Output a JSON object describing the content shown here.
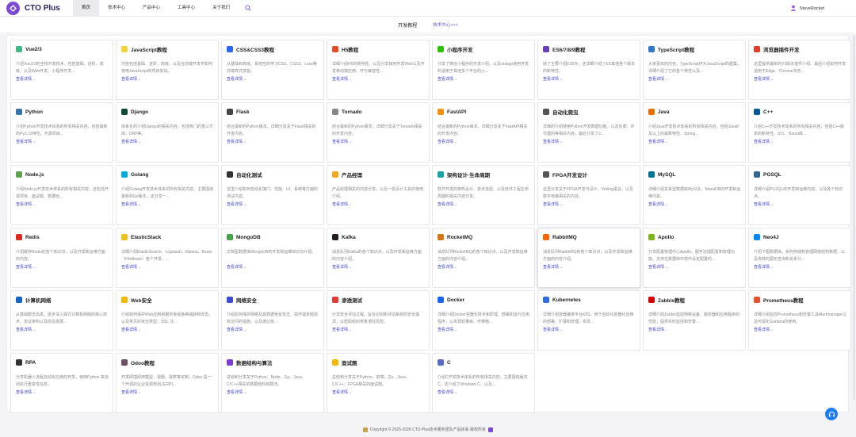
{
  "brand": {
    "name": "CTO Plus"
  },
  "nav": [
    {
      "label": "首页",
      "active": true
    },
    {
      "label": "技术中心",
      "active": false
    },
    {
      "label": "产品中心",
      "active": false
    },
    {
      "label": "工具中心",
      "active": false
    },
    {
      "label": "关于我们",
      "active": false
    }
  ],
  "user": {
    "name": "SteveRocket"
  },
  "subheader": {
    "title": "开发教程",
    "link": "技术中心>>>"
  },
  "link_label": "查看详情→",
  "cards": [
    {
      "title": "Vue2/3",
      "desc": "介绍Vue2/3的全栈开发技术。包括基础、进阶、高级，以及Web开发、小程序开发...",
      "icon": "vue-icon",
      "color": "#41b883"
    },
    {
      "title": "JavaScript教程",
      "desc": "内容包括基础、进阶、高级，以及在前端开发中如何使用JavaScript的项目实战。",
      "icon": "javascript-icon",
      "color": "#f0d43a"
    },
    {
      "title": "CSS&CSS3教程",
      "desc": "从基础到高级，系统性的学习CSS、CSS3、Less等前端样式技能。",
      "icon": "css-icon",
      "color": "#2965f1"
    },
    {
      "title": "H5教程",
      "desc": "详细介绍H5的新特性，以及分享如何开发Web以及开发移动端应用、开与兼容性...",
      "icon": "html5-icon",
      "color": "#e44d26"
    },
    {
      "title": "小程序开发",
      "desc": "分享了微信小程序的开发介绍，以及uniapp使用开发的适用于其他多个平台的小...",
      "icon": "wechat-icon",
      "color": "#2dc100"
    },
    {
      "title": "ES6/7/8/9教程",
      "desc": "除了主要介绍ES6外，还详细介绍了ES其他各个版本的新特性。",
      "icon": "es-icon",
      "color": "#6a3ec2"
    },
    {
      "title": "TypeScript教程",
      "desc": "大家喜欢的内容，TypeScript作为JavaScript的超集，详细介绍了它的各个特性以及...",
      "icon": "typescript-icon",
      "color": "#3178c6"
    },
    {
      "title": "浏览器插件开发",
      "desc": "这里提供最新的V3版本插件介绍、最后介绍如何开发适用于Edge、Chrome浏览...",
      "icon": "chrome-icon",
      "color": "#e33b2e"
    },
    {
      "title": "Python",
      "desc": "介绍Python开发技术体系的所有相关内容，包括最新的Py3.12特性，开源项目...",
      "icon": "python-icon",
      "color": "#3776ab"
    },
    {
      "title": "Django",
      "desc": "体系化的介绍Django的相关内容，包括热门的重三方库、DRF等。",
      "icon": "django-icon",
      "color": "#0c4b33"
    },
    {
      "title": "Flask",
      "desc": "结合最新的Python版本，详细分享关于Flask相关的开发内容。",
      "icon": "flask-icon",
      "color": "#444444"
    },
    {
      "title": "Tornado",
      "desc": "结合最新的Python版本，详细分享关于Tornado相关的开发内容。",
      "icon": "tornado-icon",
      "color": "#888888"
    },
    {
      "title": "FastAPI",
      "desc": "结合最新的Python版本，详细分享关于FastAPI相关的开发内容。",
      "icon": "fastapi-icon",
      "color": "#f29111"
    },
    {
      "title": "自动化爬虫",
      "desc": "详细的介绍使用Python开发数据功能，以及反爬、IP代理的等相关内容，最后分享了2...",
      "icon": "spider-icon",
      "color": "#555555"
    },
    {
      "title": "Java",
      "desc": "介绍Java开发技术体系的所有相关内容，包括Java8及以上的最新特性、Spring...",
      "icon": "java-icon",
      "color": "#e76f00"
    },
    {
      "title": "C++",
      "desc": "介绍C++开发技术体系的所有相关内容，包括C++版本的新特性、STL、Boost库...",
      "icon": "cpp-icon",
      "color": "#00599c"
    },
    {
      "title": "Node.js",
      "desc": "介绍Node.js开发技术体系的所有相关内容，还包括开源项目、面试题、数据结...",
      "icon": "nodejs-icon",
      "color": "#5fa04e"
    },
    {
      "title": "Golang",
      "desc": "介绍Golang开发技术体系的所有相关内容，主要围绕最新的Go版本，还分享一...",
      "icon": "golang-icon",
      "color": "#00add8"
    },
    {
      "title": "自动化测试",
      "desc": "这里介绍如何自动化接口、性能、UI、系统等方面的测试内容。",
      "icon": "test-icon",
      "color": "#333333"
    },
    {
      "title": "产品经理",
      "desc": "产品经理相关的内容分享，以及一些设计工具的使用介绍。",
      "icon": "product-icon",
      "color": "#f5a623"
    },
    {
      "title": "架构设计·生命周期",
      "desc": "软件开发的架构设计、技术选型、以及软件工程生命周期的相关内容分享。",
      "icon": "architecture-icon",
      "color": "#1aa3a3"
    },
    {
      "title": "FPGA开发设计",
      "desc": "这里分享关于FPGA开发与设计、Verilog语言，以及数字电路相关的内容。",
      "icon": "fpga-icon",
      "color": "#555555"
    },
    {
      "title": "MySQL",
      "desc": "详细介绍关系型数据库MySQL、MariaDB的开发和运维内容。",
      "icon": "mysql-icon",
      "color": "#00758f"
    },
    {
      "title": "PGSQL",
      "desc": "详细介绍PGSQL的开发和运维内容，以及各个知识点。",
      "icon": "postgresql-icon",
      "color": "#336791"
    },
    {
      "title": "Redis",
      "desc": "介绍缓存Redis的各个知识点，以及开发和运维方面的内容。",
      "icon": "redis-icon",
      "color": "#d82c20"
    },
    {
      "title": "ElasticStack",
      "desc": "详细介绍ElasticSearch、Logstash、Kibana、Beats（FileBeats）各个开发、...",
      "icon": "elastic-icon",
      "color": "#f0bf1a"
    },
    {
      "title": "MongoDB",
      "desc": "文档型数据库MongoDB的开发和运维知识点介绍。",
      "icon": "mongodb-icon",
      "color": "#47a248"
    },
    {
      "title": "Kafka",
      "desc": "消息队列Kafka的各个知识点，以及开发和运维方面的内容介绍。",
      "icon": "kafka-icon",
      "color": "#231f20"
    },
    {
      "title": "RocketMQ",
      "desc": "消息队列RocketMQ的各个知识点，以及开发和运维方面的内容介绍。",
      "icon": "rocketmq-icon",
      "color": "#d77310"
    },
    {
      "title": "RabbitMQ",
      "desc": "消息队列RabbitMQ的各个知识点，以及开发和运维方面的内容介绍。",
      "icon": "rabbitmq-icon",
      "color": "#ff6600"
    },
    {
      "title": "Apollo",
      "desc": "分享配置管理中心Apollo、服务治理配置和管理功能，支持在数据库环境中设定配置的...",
      "icon": "apollo-icon",
      "color": "#7cb518"
    },
    {
      "title": "Neo4J",
      "desc": "介绍下图数据库，如何存储和管理网络结构数据，以及高效的图形查询和关系分...",
      "icon": "neo4j-icon",
      "color": "#018bff"
    },
    {
      "title": "计算机网络",
      "desc": "从基础概念出发，逐步深入探讨计算机网络的核心技术、协议架构以及前沿发展...",
      "icon": "network-icon",
      "color": "#1565c0"
    },
    {
      "title": "Web安全",
      "desc": "介绍如何保护Web应用和服务免受各种威胁和攻击，以及常见的攻击类型、SQL 注...",
      "icon": "shield-icon",
      "color": "#f5b700"
    },
    {
      "title": "网络安全",
      "desc": "介绍如何保护网络及其数据免受攻击、损坏或未经授权访问的措施，以及通过技...",
      "icon": "security-icon",
      "color": "#3c4bd0"
    },
    {
      "title": "渗透测试",
      "desc": "分享安全评估过程，旨在识别和评估系统的安全漏洞，以帮助组织修复潜在风险。",
      "icon": "pentest-icon",
      "color": "#e53935"
    },
    {
      "title": "Docker",
      "desc": "详细介绍Docker容器化技术和原理、部署和运行应用程序，以实现轻量级、可移植...",
      "icon": "docker-icon",
      "color": "#1d63ed"
    },
    {
      "title": "Kubernetes",
      "desc": "详细介绍容器编排平台K8S，用于自动化容器化应用的部署、扩展和管理，实现...",
      "icon": "kubernetes-icon",
      "color": "#326ce5"
    },
    {
      "title": "Zabbix教程",
      "desc": "详细介绍Zabbix监控网络设备、服务器和应用程序的性能，提供实时监控和告警...",
      "icon": "zabbix-icon",
      "color": "#d40000"
    },
    {
      "title": "Prometheus教程",
      "desc": "详细介绍监控Prometheus和告警工具Alertmanager以及可视化Grafana的使用。",
      "icon": "prometheus-icon",
      "color": "#e6522c"
    },
    {
      "title": "RPA",
      "desc": "分享机器人流程自动化应用的开发，使用Python 来自动执行重复性任务。",
      "icon": "rpa-icon",
      "color": "#333333"
    },
    {
      "title": "Odoo教程",
      "desc": "开发即插即用模型、视图、报表等定制，Odoo 是一个开源的企业资源规划 (ERP)...",
      "icon": "odoo-icon",
      "color": "#714b67"
    },
    {
      "title": "数据结构与算法",
      "desc": "总结和分享关于Python、Node、Go、Java、C/C++相关的数据结构和算法。",
      "icon": "algorithm-icon",
      "color": "#7a3fd1"
    },
    {
      "title": "面试题",
      "desc": "总结和分享关于Python、前端、Go、Java、C/C++、FPGA相关的面试题。",
      "icon": "interview-icon",
      "color": "#f5b700"
    },
    {
      "title": "C",
      "desc": "介绍C开发技术体系的所有相关内容，主要围绕版本C、还介绍了Windows C、以及...",
      "icon": "c-icon",
      "color": "#5c6bc0"
    }
  ],
  "footer": {
    "text": "Copyright © 2025-2026 CTO Plus技术服务团队产品体系 版权所有"
  }
}
